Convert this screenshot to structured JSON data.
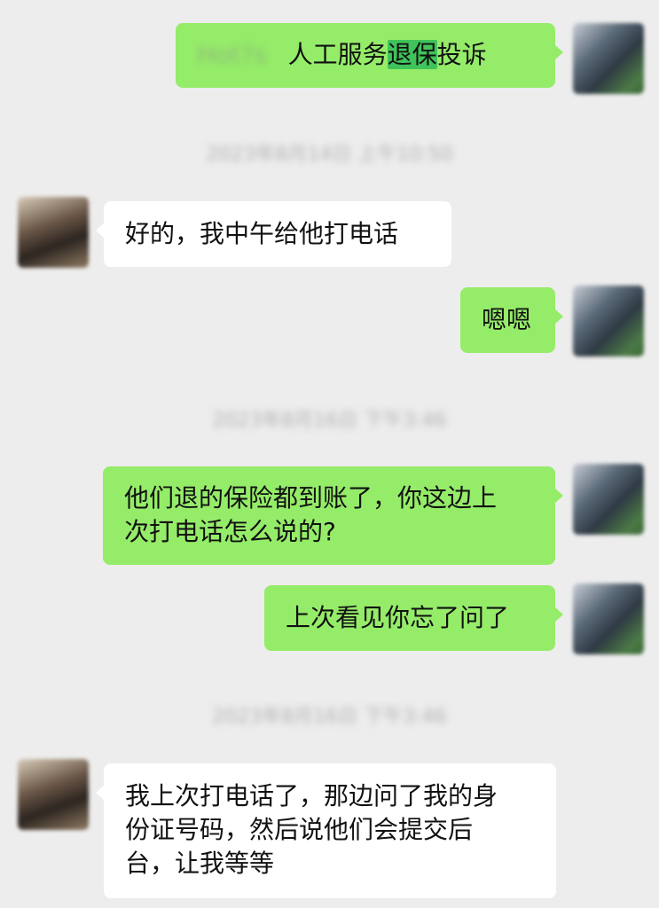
{
  "messages": [
    {
      "side": "right",
      "blurred_prefix": "Hot?s",
      "pre": "人工服务",
      "highlight": "退保",
      "post": "投诉"
    },
    {
      "timestamp": "2023年8月14日 上午10:50"
    },
    {
      "side": "left",
      "text": "好的，我中午给他打电话"
    },
    {
      "side": "right",
      "text": "嗯嗯"
    },
    {
      "timestamp": "2023年8月16日 下午3:46"
    },
    {
      "side": "right",
      "text_line1": "他们退的保险都到账了，你这边上",
      "text_line2": "次打电话怎么说的?"
    },
    {
      "side": "right",
      "text": "上次看见你忘了问了"
    },
    {
      "timestamp": "2023年8月16日 下午3:46"
    },
    {
      "side": "left",
      "text_line1": "我上次打电话了，那边问了我的身",
      "text_line2": "份证号码，然后说他们会提交后",
      "text_line3": "台，让我等等"
    }
  ],
  "colors": {
    "background": "#ededed",
    "my_bubble": "#95ec69",
    "their_bubble": "#ffffff",
    "highlight": "#3fc35a"
  }
}
